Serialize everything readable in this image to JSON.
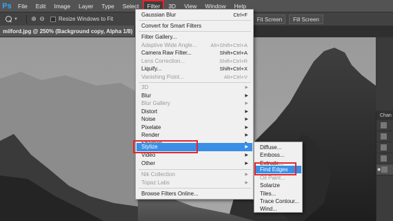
{
  "app": {
    "logo": "Ps"
  },
  "menubar": {
    "items": [
      "File",
      "Edit",
      "Image",
      "Layer",
      "Type",
      "Select",
      "Filter",
      "3D",
      "View",
      "Window",
      "Help"
    ]
  },
  "options": {
    "resize_windows_label": "Resize Windows to Fit",
    "fit_screen_label": "Fit Screen",
    "fill_screen_label": "Fill Screen"
  },
  "document": {
    "tab_title": "milford.jpg @ 250% (Background copy, Alpha 1/8)"
  },
  "filter_menu": {
    "last_filter": {
      "label": "Gaussian Blur",
      "shortcut": "Ctrl+F"
    },
    "convert_smart": "Convert for Smart Filters",
    "filter_gallery": "Filter Gallery...",
    "adaptive_wide_angle": {
      "label": "Adaptive Wide Angle...",
      "shortcut": "Alt+Shift+Ctrl+A"
    },
    "camera_raw": {
      "label": "Camera Raw Filter...",
      "shortcut": "Shift+Ctrl+A"
    },
    "lens_correction": {
      "label": "Lens Correction...",
      "shortcut": "Shift+Ctrl+R"
    },
    "liquify": {
      "label": "Liquify...",
      "shortcut": "Shift+Ctrl+X"
    },
    "vanishing_point": {
      "label": "Vanishing Point...",
      "shortcut": "Alt+Ctrl+V"
    },
    "group_3d": "3D",
    "blur": "Blur",
    "blur_gallery": "Blur Gallery",
    "distort": "Distort",
    "noise": "Noise",
    "pixelate": "Pixelate",
    "render": "Render",
    "sharpen": "Sharpen",
    "stylize": "Stylize",
    "video": "Video",
    "other": "Other",
    "nik_collection": "Nik Collection",
    "topaz_labs": "Topaz Labs",
    "browse_online": "Browse Filters Online..."
  },
  "stylize_submenu": {
    "items": [
      "Diffuse...",
      "Emboss...",
      "Extrude...",
      "Find Edges",
      "Oil Paint...",
      "Solarize",
      "Tiles...",
      "Trace Contour...",
      "Wind..."
    ]
  },
  "panel": {
    "title": "Chan"
  },
  "colors": {
    "highlight": "#3a8ee6",
    "annotation_red": "#e3262b",
    "ps_blue": "#31a8ff"
  }
}
